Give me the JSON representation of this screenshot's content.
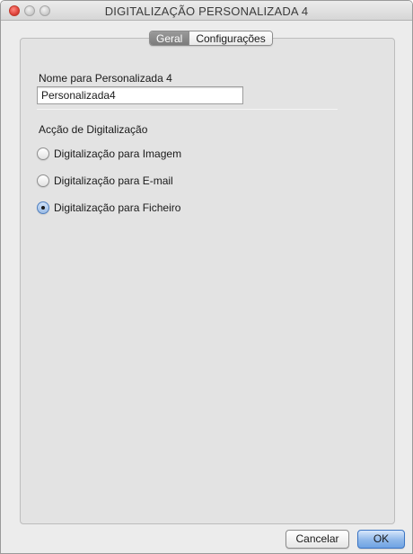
{
  "window": {
    "title": "DIGITALIZAÇÃO PERSONALIZADA 4"
  },
  "tabs": [
    {
      "label": "Geral",
      "active": true
    },
    {
      "label": "Configurações",
      "active": false
    }
  ],
  "general": {
    "name_label": "Nome para Personalizada 4",
    "name_value": "Personalizada4",
    "action_label": "Acção de Digitalização",
    "options": [
      {
        "label": "Digitalização para Imagem",
        "selected": false
      },
      {
        "label": "Digitalização para E-mail",
        "selected": false
      },
      {
        "label": "Digitalização para Ficheiro",
        "selected": true
      }
    ]
  },
  "buttons": {
    "cancel_label": "Cancelar",
    "ok_label": "OK"
  },
  "colors": {
    "accent": "#6fa3e3",
    "close_button": "#e0443e"
  }
}
